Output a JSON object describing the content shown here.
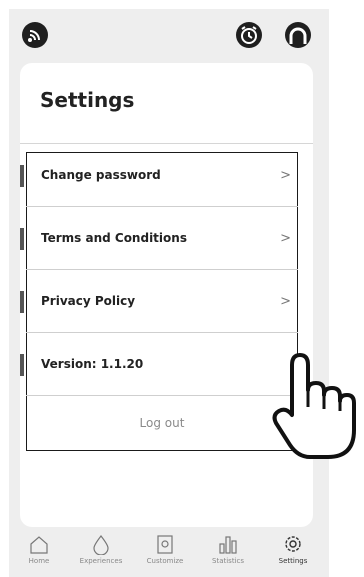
{
  "header": {
    "left_icon": "connection-icon",
    "right_icons": [
      "alarm-clock-icon",
      "profile-icon"
    ]
  },
  "settings": {
    "title": "Settings",
    "items": [
      {
        "label": "Change password",
        "chevron": ">"
      },
      {
        "label": "Terms and Conditions",
        "chevron": ">"
      },
      {
        "label": "Privacy Policy",
        "chevron": ">"
      },
      {
        "label": "Version: 1.1.20"
      }
    ],
    "logout": "Log out"
  },
  "nav": {
    "items": [
      {
        "label": "Home",
        "icon": "home-icon"
      },
      {
        "label": "Experiences",
        "icon": "drop-icon"
      },
      {
        "label": "Customize",
        "icon": "customize-icon"
      },
      {
        "label": "Statistics",
        "icon": "statistics-icon"
      },
      {
        "label": "Settings",
        "icon": "gear-icon",
        "active": true
      }
    ]
  },
  "colors": {
    "background": "#eeeeee",
    "card": "#ffffff",
    "text": "#222222"
  }
}
